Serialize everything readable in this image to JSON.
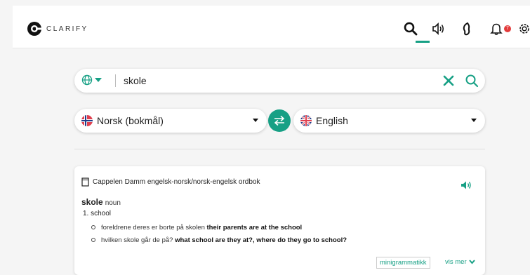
{
  "app": {
    "logo_text": "CLARIFY"
  },
  "nav": {
    "notification_count": "7",
    "icons": [
      "search-icon",
      "speaker-icon",
      "ear-icon",
      "bell-icon",
      "gear-icon"
    ]
  },
  "search": {
    "value": "skole",
    "placeholder": ""
  },
  "languages": {
    "source": "Norsk (bokmål)",
    "target": "English"
  },
  "entry": {
    "source_name": "Cappelen Damm engelsk-norsk/norsk-engelsk ordbok",
    "headword": "skole",
    "pos": "noun",
    "sense": "1. school",
    "examples": [
      {
        "no": "foreldrene deres er borte på skolen",
        "en": "their parents are at the school"
      },
      {
        "no": "hvilken skole går de på?",
        "en": "what school are they at?, where do they go to school?"
      }
    ],
    "mini_label": "minigrammatikk",
    "more_label": "vis mer"
  },
  "colors": {
    "accent": "#17a085",
    "badge": "#e33b3b"
  }
}
